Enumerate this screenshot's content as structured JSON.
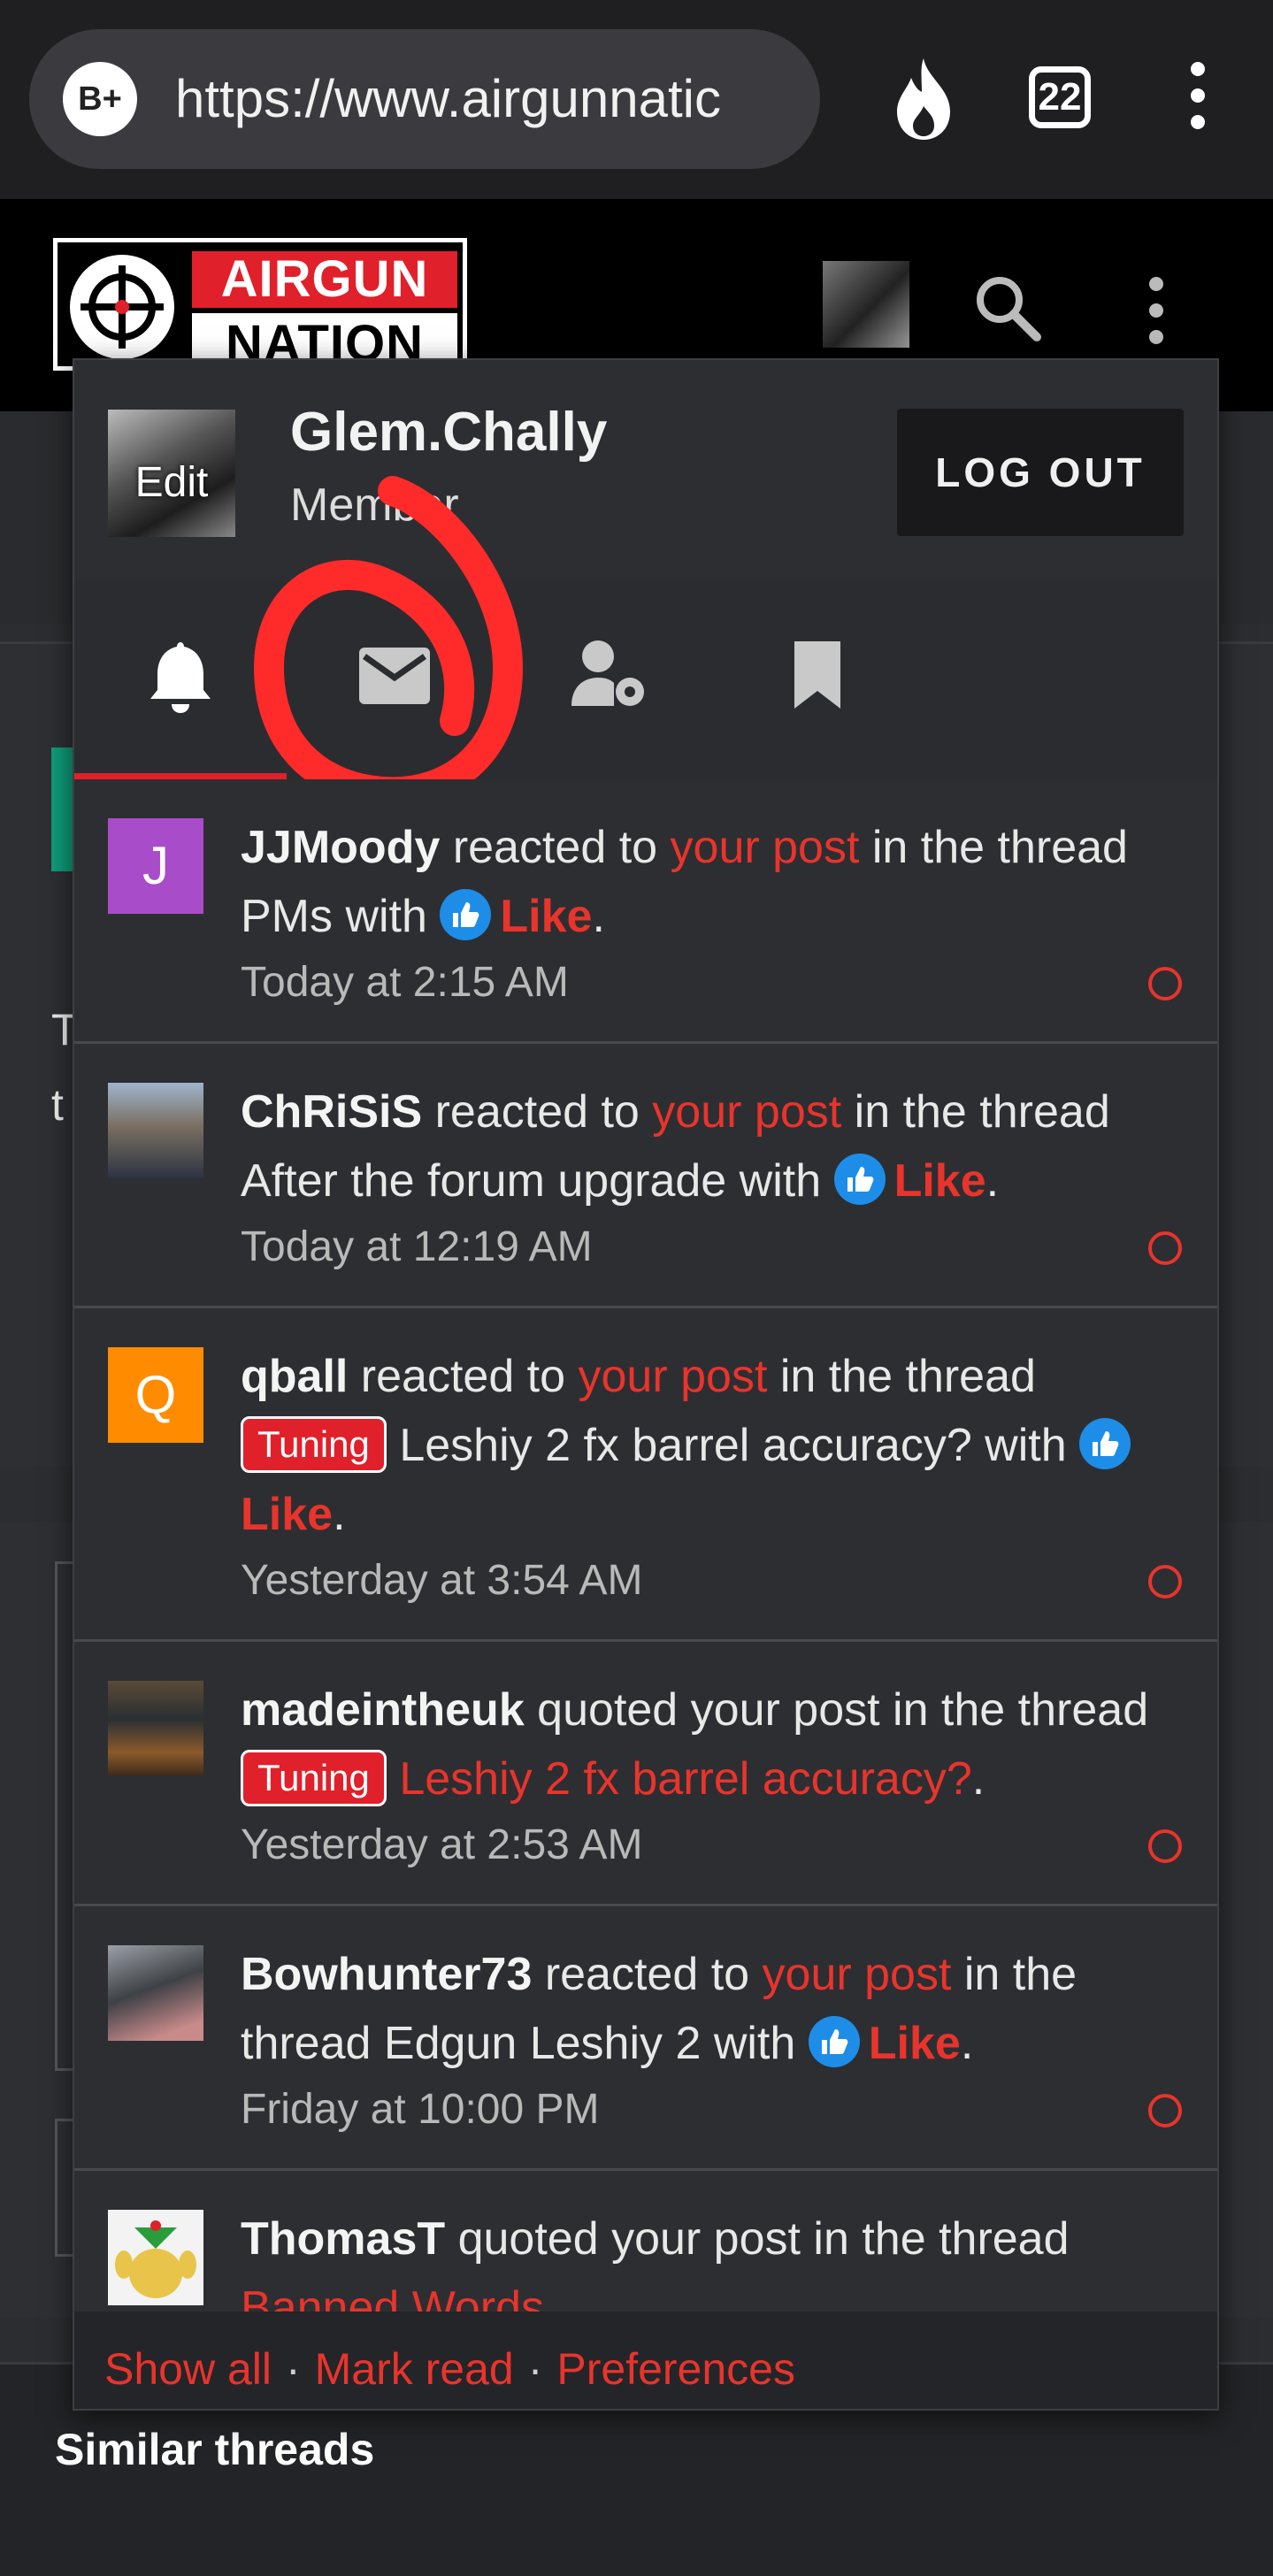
{
  "browser": {
    "site_badge": "B+",
    "url": "https://www.airgunnatic",
    "tab_count": "22"
  },
  "site": {
    "logo_top": "AIRGUN",
    "logo_bottom": "NATION"
  },
  "account": {
    "avatar_edit": "Edit",
    "username": "Glem.Chally",
    "role": "Member",
    "logout_label": "LOG OUT"
  },
  "tabs": [
    {
      "icon": "bell-icon",
      "active": true
    },
    {
      "icon": "envelope-icon",
      "active": false
    },
    {
      "icon": "user-gear-icon",
      "active": false
    },
    {
      "icon": "bookmark-icon",
      "active": false
    }
  ],
  "alerts": [
    {
      "avatar_letter": "J",
      "avatar_color": "#a94cc9",
      "user": "JJMoody",
      "t1": " reacted to ",
      "link": "your post",
      "t2": " in the thread PMs with ",
      "reaction": "Like",
      "t3": ".",
      "time": "Today at 2:15 AM"
    },
    {
      "avatar_letter": "",
      "avatar_color": "#7d8a9b",
      "user": "ChRiSiS",
      "t1": " reacted to ",
      "link": "your post",
      "t2": " in the thread After the forum upgrade with ",
      "reaction": "Like",
      "t3": ".",
      "time": "Today at 12:19 AM"
    },
    {
      "avatar_letter": "Q",
      "avatar_color": "#ff8c00",
      "user": "qball",
      "t1": " reacted to ",
      "link": "your post",
      "t2": " in the thread ",
      "tag": "Tuning",
      "t2b": " Leshiy 2 fx barrel accuracy? with ",
      "reaction": "Like",
      "t3": ".",
      "time": "Yesterday at 3:54 AM"
    },
    {
      "avatar_letter": "",
      "avatar_color": "#4a3a2a",
      "user": "madeintheuk",
      "t1": " quoted your post in the thread ",
      "tag": "Tuning",
      "thread_link": "Leshiy 2 fx barrel accuracy?",
      "t3": ".",
      "time": "Yesterday at 2:53 AM"
    },
    {
      "avatar_letter": "",
      "avatar_color": "#6d6f74",
      "user": "Bowhunter73",
      "t1": " reacted to ",
      "link": "your post",
      "t2": " in the thread Edgun Leshiy 2 with ",
      "reaction": "Like",
      "t3": ".",
      "time": "Friday at 10:00 PM"
    },
    {
      "avatar_letter": "",
      "avatar_color": "#f3f3f3",
      "user": "ThomasT",
      "t1": " quoted your post in the thread ",
      "thread_link": "Banned Words"
    }
  ],
  "footer": {
    "show_all": "Show all",
    "mark_read": "Mark read",
    "preferences": "Preferences",
    "sep": "·"
  },
  "page": {
    "similar_threads": "Similar threads",
    "bg_letter_1": "T",
    "bg_letter_2": "t"
  },
  "colors": {
    "accent": "#e0202a",
    "link_red": "#e8342c",
    "like_blue": "#1d8de8"
  }
}
